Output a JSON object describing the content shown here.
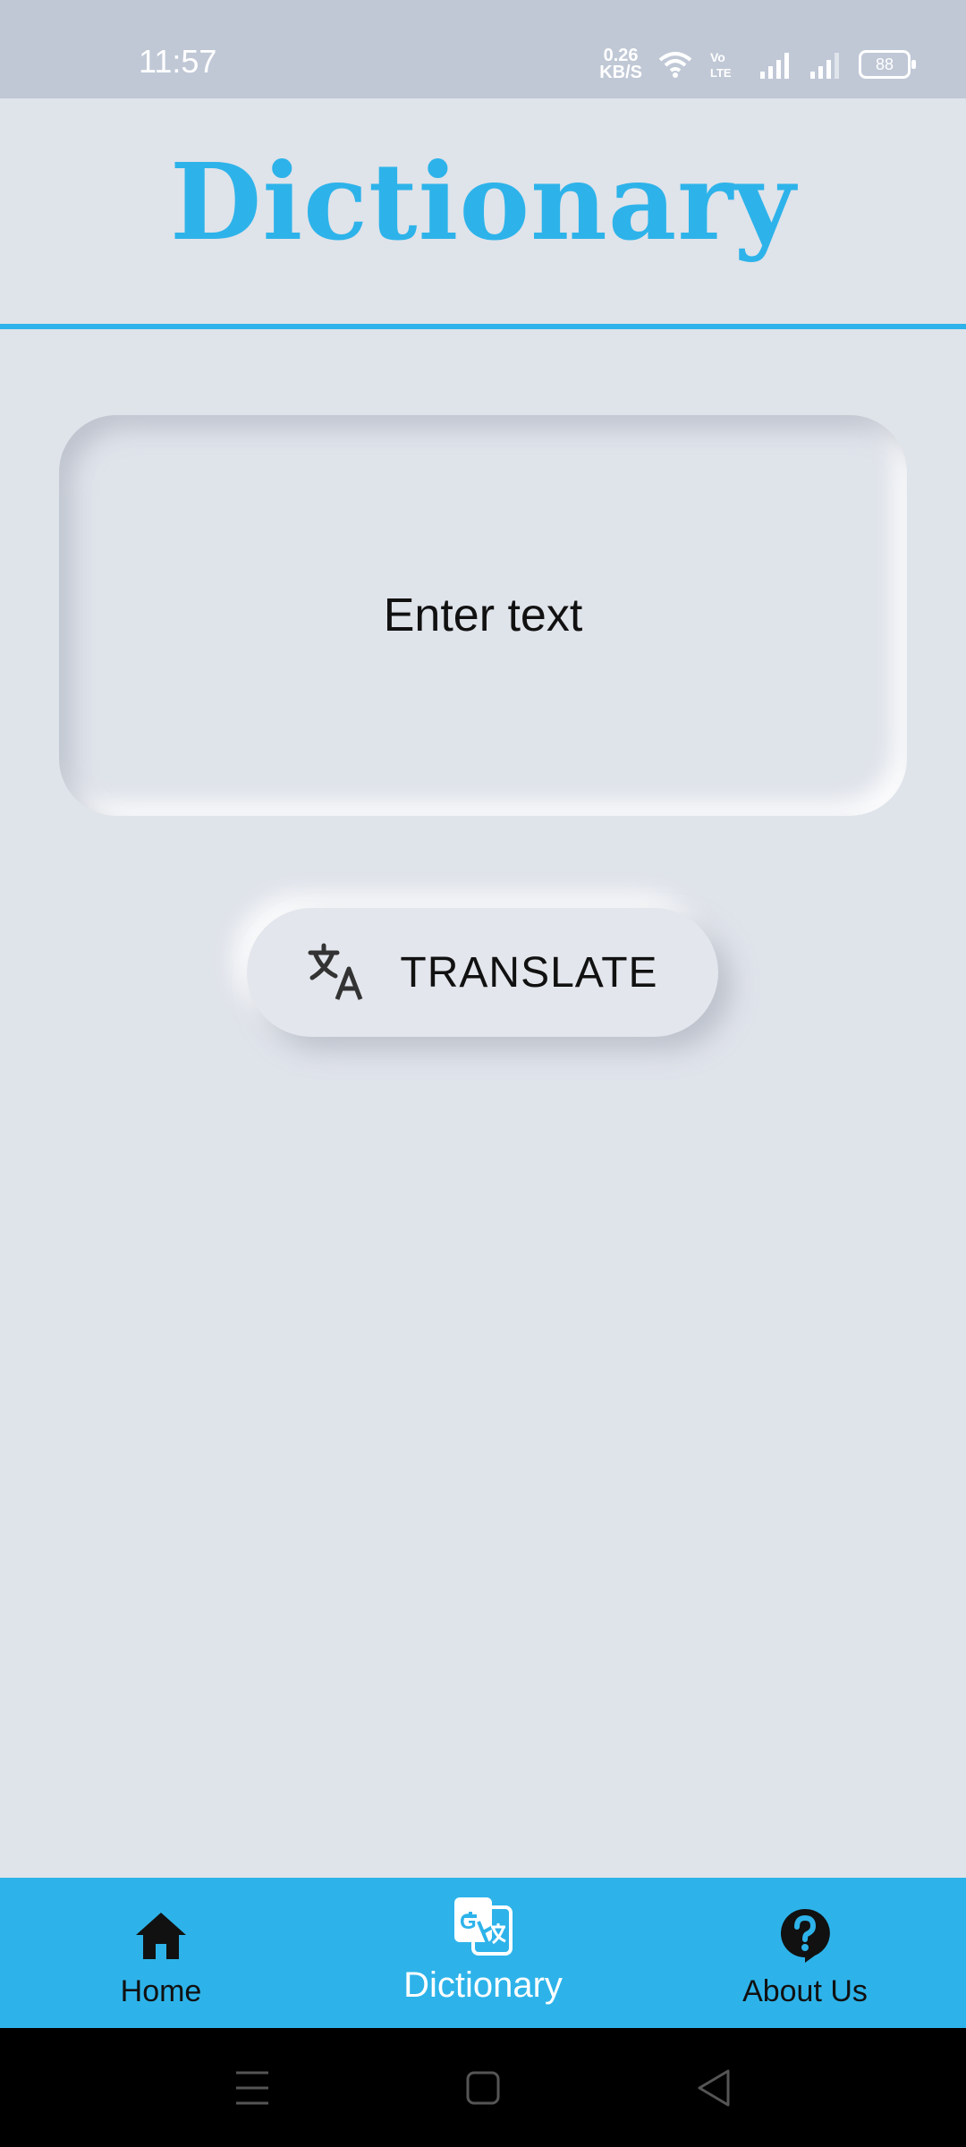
{
  "status_bar": {
    "time": "11:57",
    "speed_value": "0.26",
    "speed_unit": "KB/S",
    "volte": "Vo LTE",
    "battery": "88"
  },
  "header": {
    "title": "Dictionary"
  },
  "input": {
    "placeholder": "Enter text"
  },
  "translate_button": {
    "label": "TRANSLATE",
    "icon": "translate-icon"
  },
  "bottom_nav": {
    "items": [
      {
        "label": "Home",
        "icon": "home-icon"
      },
      {
        "label": "Dictionary",
        "icon": "google-translate-icon",
        "active": true
      },
      {
        "label": "About Us",
        "icon": "help-icon"
      }
    ]
  },
  "colors": {
    "accent": "#2db3ea",
    "background": "#dfe3ea",
    "status_bar": "#c0c8d6"
  }
}
